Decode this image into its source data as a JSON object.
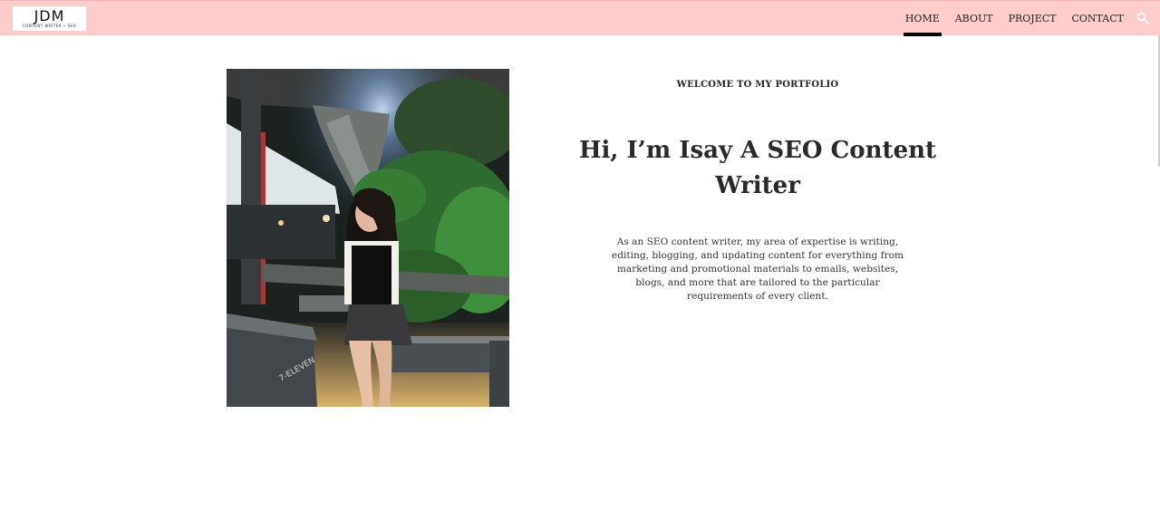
{
  "header": {
    "logo": {
      "mark": "JDM",
      "subtitle": "CONTENT WRITER • SEO"
    },
    "nav": [
      {
        "label": "HOME",
        "active": true
      },
      {
        "label": "ABOUT",
        "active": false
      },
      {
        "label": "PROJECT",
        "active": false
      },
      {
        "label": "CONTACT",
        "active": false
      }
    ],
    "search_icon": "search-icon",
    "background_color": "#ffcccc"
  },
  "hero": {
    "photo": "portrait-photo",
    "eyebrow": "WELCOME TO MY PORTFOLIO",
    "headline_line1": "Hi, I’m Isay A SEO Content",
    "headline_line2": "Writer",
    "intro": "As an SEO content writer, my area of expertise is writing, editing, blogging, and updating content for everything from marketing and promotional materials to emails, websites, blogs, and more that are tailored to the particular requirements of every client."
  }
}
